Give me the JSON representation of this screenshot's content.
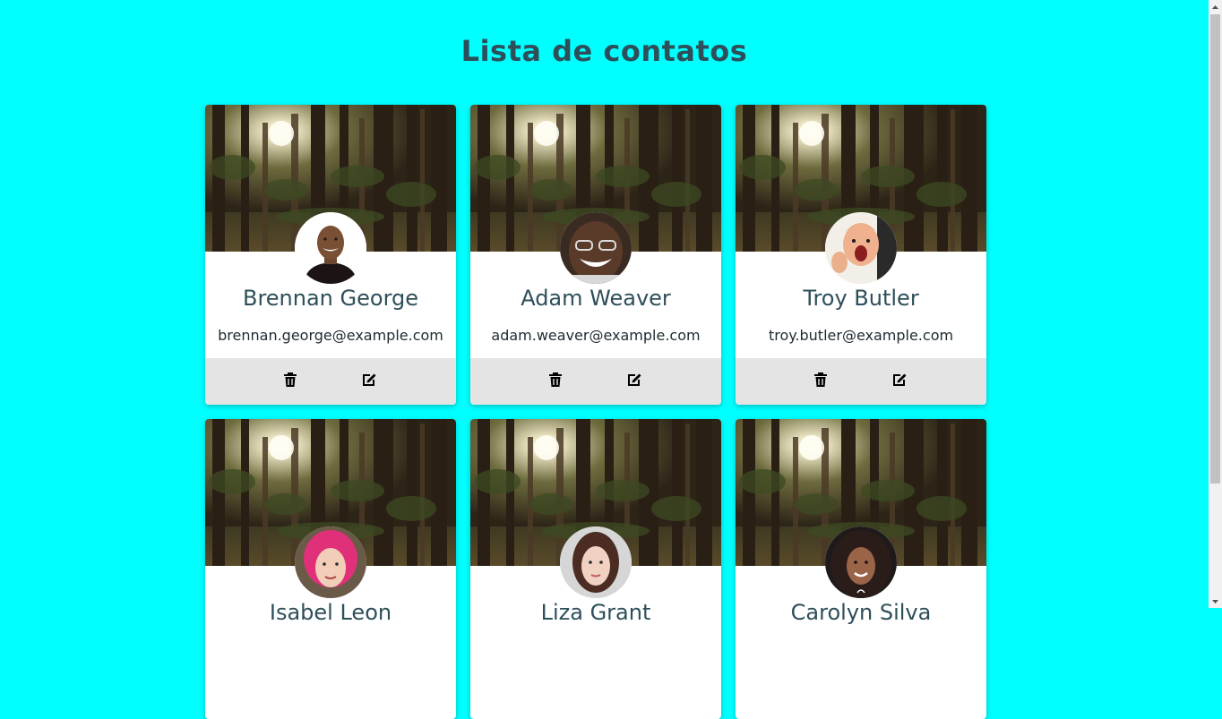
{
  "page": {
    "title": "Lista de contatos"
  },
  "contacts": [
    {
      "name": "Brennan George",
      "email": "brennan.george@example.com",
      "avatar": "avatar-man-bald-smiling"
    },
    {
      "name": "Adam Weaver",
      "email": "adam.weaver@example.com",
      "avatar": "avatar-man-glasses-laughing"
    },
    {
      "name": "Troy Butler",
      "email": "troy.butler@example.com",
      "avatar": "avatar-man-excited"
    },
    {
      "name": "Isabel Leon",
      "email": "",
      "avatar": "avatar-woman-pink-hair"
    },
    {
      "name": "Liza Grant",
      "email": "",
      "avatar": "avatar-woman-brunette"
    },
    {
      "name": "Carolyn Silva",
      "email": "",
      "avatar": "avatar-woman-curly-hair"
    }
  ],
  "icons": {
    "delete": "trash-icon",
    "edit": "edit-icon"
  },
  "colors": {
    "background": "#00ffff",
    "title": "#2e4f5a",
    "actions_bar": "#e4e4e4"
  }
}
